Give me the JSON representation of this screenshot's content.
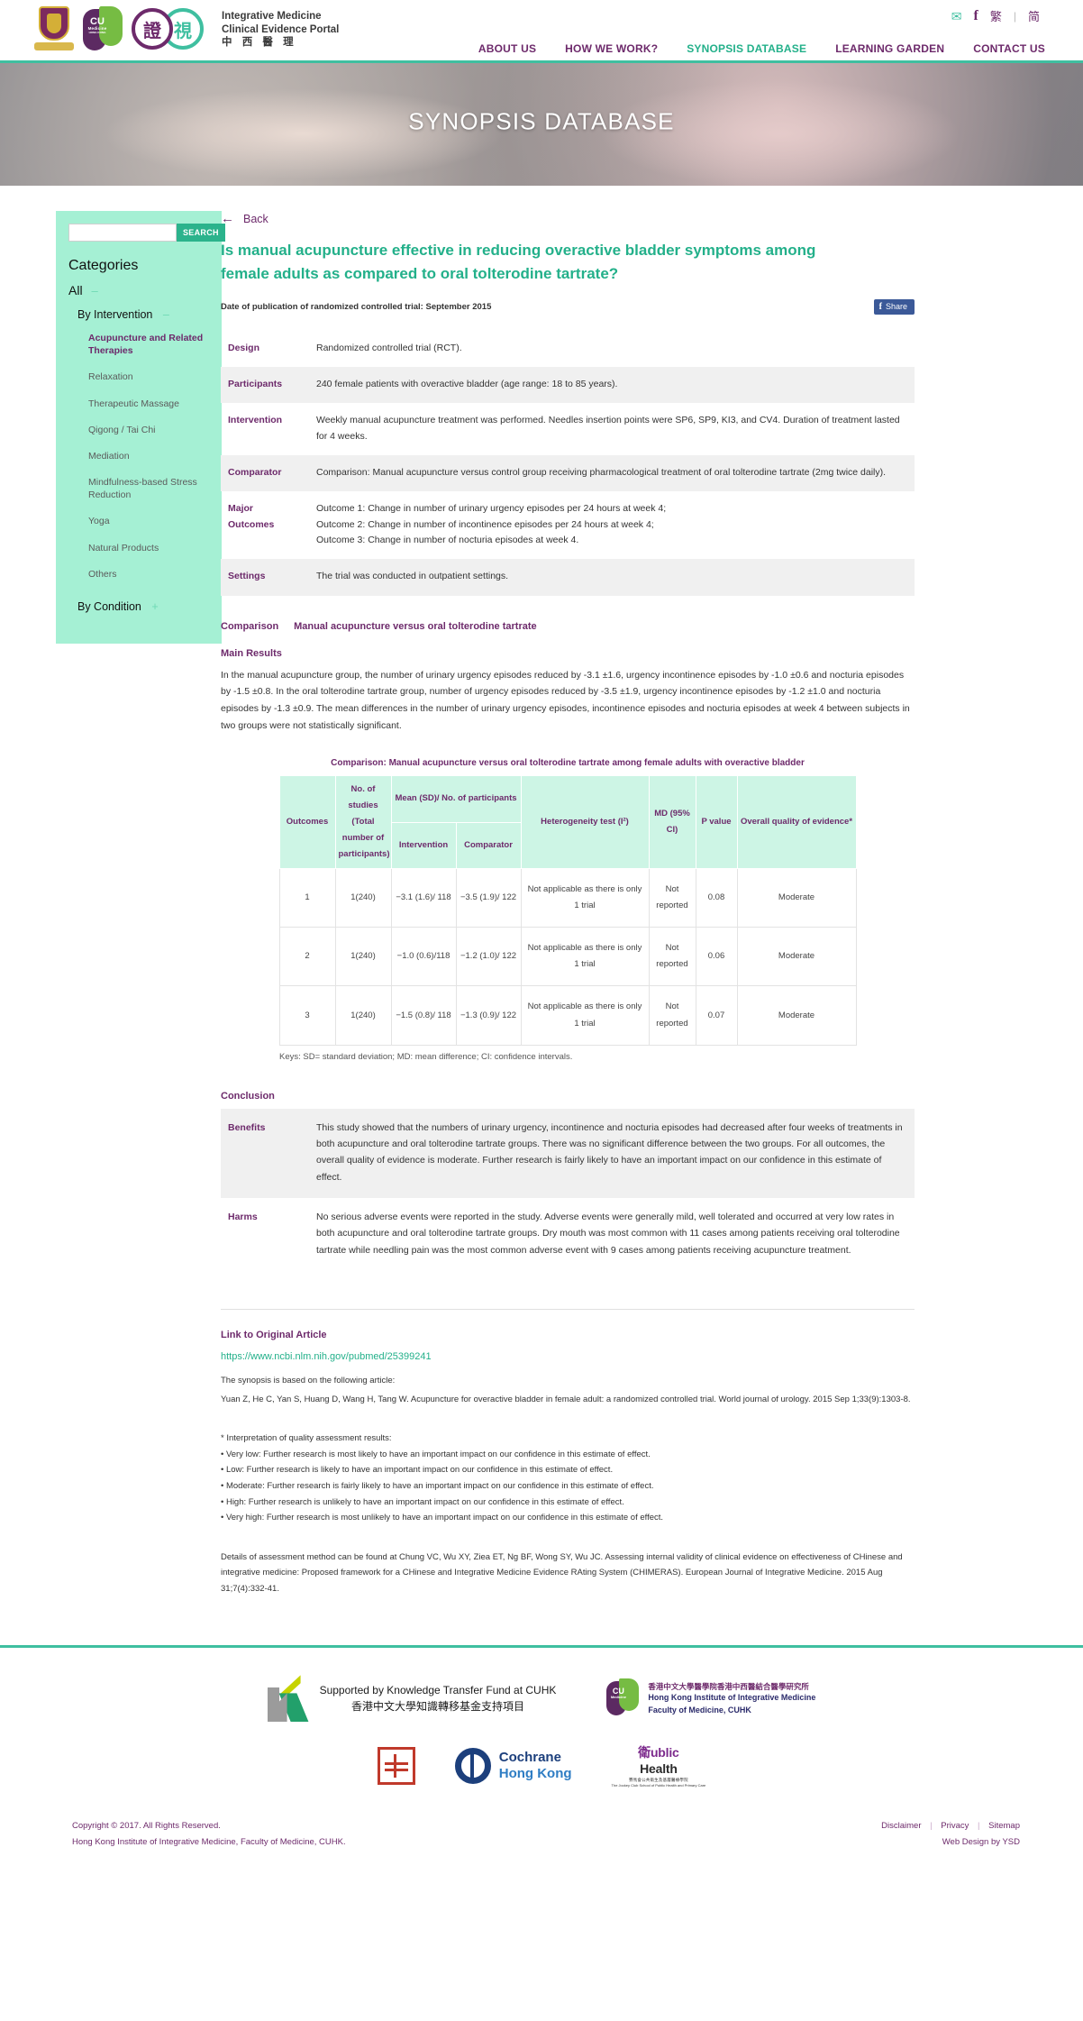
{
  "header": {
    "brand": {
      "line1": "Integrative Medicine",
      "line2": "Clinical Evidence Portal",
      "line3": "中 西 醫 理"
    },
    "logo_cu": "CU",
    "logo_cu_sub": "Medicine",
    "logo_cu_sub2": "HONG KONG",
    "logo_mark_left": "證",
    "logo_mark_right": "視",
    "mail_icon": "✉",
    "facebook_icon": "f",
    "lang_trad": "繁",
    "lang_sep": "|",
    "lang_simp": "简",
    "nav": [
      {
        "label": "ABOUT US",
        "active": false
      },
      {
        "label": "HOW WE WORK?",
        "active": false
      },
      {
        "label": "SYNOPSIS DATABASE",
        "active": true
      },
      {
        "label": "LEARNING GARDEN",
        "active": false
      },
      {
        "label": "CONTACT US",
        "active": false
      }
    ]
  },
  "banner": {
    "title": "SYNOPSIS DATABASE"
  },
  "sidebar": {
    "search_value": "",
    "search_placeholder": "",
    "search_button": "SEARCH",
    "categories_title": "Categories",
    "all_label": "All",
    "all_toggle": "–",
    "by_intervention_label": "By Intervention",
    "by_intervention_toggle": "–",
    "intervention_items": [
      {
        "label": "Acupuncture and Related Therapies",
        "active": true
      },
      {
        "label": "Relaxation",
        "active": false
      },
      {
        "label": "Therapeutic Massage",
        "active": false
      },
      {
        "label": "Qigong / Tai Chi",
        "active": false
      },
      {
        "label": "Mediation",
        "active": false
      },
      {
        "label": "Mindfulness-based Stress Reduction",
        "active": false
      },
      {
        "label": "Yoga",
        "active": false
      },
      {
        "label": "Natural Products",
        "active": false
      },
      {
        "label": "Others",
        "active": false
      }
    ],
    "by_condition_label": "By Condition",
    "by_condition_toggle": "+"
  },
  "main": {
    "back_arrow": "←",
    "back_label": "Back",
    "title": "Is manual acupuncture effective in reducing overactive bladder symptoms among female adults as compared to oral tolterodine tartrate?",
    "publication_date": "Date of publication of randomized controlled trial: September 2015",
    "share_label": "Share",
    "share_icon": "f",
    "info_rows": [
      {
        "label": "Design",
        "value": "Randomized controlled trial (RCT)."
      },
      {
        "label": "Participants",
        "value": "240 female patients with overactive bladder (age range: 18 to 85 years)."
      },
      {
        "label": "Intervention",
        "value": "Weekly manual acupuncture treatment was performed. Needles insertion points were SP6, SP9, KI3, and CV4. Duration of treatment lasted for 4 weeks."
      },
      {
        "label": "Comparator",
        "value": "Comparison: Manual acupuncture versus control group receiving pharmacological treatment of oral tolterodine tartrate (2mg twice daily)."
      },
      {
        "label": "Major Outcomes",
        "value": "Outcome 1: Change in number of urinary urgency episodes per 24 hours at week 4;\nOutcome 2: Change in number of incontinence episodes per 24 hours at week 4;\nOutcome 3: Change in number of nocturia episodes at week 4."
      },
      {
        "label": "Settings",
        "value": "The trial was conducted in outpatient settings."
      }
    ],
    "comparison_label": "Comparison",
    "comparison_value": "Manual acupuncture versus oral tolterodine tartrate",
    "main_results_label": "Main Results",
    "main_results_text": "In the manual acupuncture group, the number of urinary urgency episodes reduced by -3.1 ±1.6, urgency incontinence episodes by -1.0 ±0.6 and nocturia episodes by -1.5 ±0.8. In the oral tolterodine tartrate group, number of urgency episodes reduced by -3.5 ±1.9, urgency incontinence episodes by -1.2 ±1.0 and nocturia episodes by -1.3 ±0.9. The mean differences in the number of urinary urgency episodes, incontinence episodes and nocturia episodes at week 4 between subjects in two groups were not statistically significant.",
    "table_caption": "Comparison: Manual acupuncture versus oral tolterodine tartrate among female adults with overactive bladder",
    "table_keys": "Keys: SD= standard deviation; MD: mean difference; CI: confidence intervals.",
    "conclusion_label": "Conclusion",
    "conclusion_rows": [
      {
        "label": "Benefits",
        "value": "This study showed that the numbers of urinary urgency, incontinence and nocturia episodes had decreased after four weeks of treatments in both acupuncture and oral tolterodine tartrate groups. There was no significant difference between the two groups. For all outcomes, the overall quality of evidence is moderate. Further research is fairly likely to have an important impact on our confidence in this estimate of effect."
      },
      {
        "label": "Harms",
        "value": "No serious adverse events were reported in the study. Adverse events were generally mild, well tolerated and occurred at very low rates in both acupuncture and oral tolterodine tartrate groups. Dry mouth was most common with 11 cases among patients receiving oral tolterodine tartrate while needling pain was the most common adverse event with 9 cases among patients receiving acupuncture treatment."
      }
    ],
    "link_heading": "Link to Original Article",
    "link_url": "https://www.ncbi.nlm.nih.gov/pubmed/25399241",
    "based_on_label": "The synopsis is based on the following article:",
    "citation": "Yuan Z, He C, Yan S, Huang D, Wang H, Tang W. Acupuncture for overactive bladder in female adult: a randomized controlled trial. World journal of urology. 2015 Sep 1;33(9):1303-8.",
    "interp_heading": "* Interpretation of quality assessment results:",
    "interp_bullets": [
      "• Very low: Further research is most likely to have an important impact on our confidence in this estimate of effect.",
      "• Low: Further research is likely to have an important impact on our confidence in this estimate of effect.",
      "• Moderate: Further research is fairly likely to have an important impact on our confidence in this estimate of effect.",
      "• High: Further research is unlikely to have an important impact on our confidence in this estimate of effect.",
      "• Very high: Further research is most unlikely to have an important impact on our confidence in this estimate of effect."
    ],
    "assessment_note": "Details of assessment method can be found at Chung VC, Wu XY, Ziea ET, Ng BF, Wong SY, Wu JC. Assessing internal validity of clinical evidence on effectiveness of CHinese and integrative medicine: Proposed framework for a CHinese and Integrative Medicine Evidence RAting System (CHIMERAS). European Journal of Integrative Medicine. 2015 Aug 31;7(4):332-41."
  },
  "chart_data": {
    "type": "table",
    "title": "Comparison: Manual acupuncture versus oral tolterodine tartrate among female adults with overactive bladder",
    "columns": [
      "Outcomes",
      "No. of studies (Total number of participants)",
      "Mean (SD)/ No. of participants",
      "Heterogeneity test (I²)",
      "MD (95% CI)",
      "P value",
      "Overall quality of evidence*"
    ],
    "subcolumns": [
      "Intervention",
      "Comparator"
    ],
    "rows": [
      {
        "outcome": "1",
        "studies": "1(240)",
        "intervention": "−3.1 (1.6)/ 118",
        "comparator": "−3.5 (1.9)/ 122",
        "heterogeneity": "Not applicable as there is only 1 trial",
        "md": "Not reported",
        "p_value": "0.08",
        "quality": "Moderate"
      },
      {
        "outcome": "2",
        "studies": "1(240)",
        "intervention": "−1.0 (0.6)/118",
        "comparator": "−1.2 (1.0)/ 122",
        "heterogeneity": "Not applicable as there is only 1 trial",
        "md": "Not reported",
        "p_value": "0.06",
        "quality": "Moderate"
      },
      {
        "outcome": "3",
        "studies": "1(240)",
        "intervention": "−1.5 (0.8)/ 118",
        "comparator": "−1.3 (0.9)/ 122",
        "heterogeneity": "Not applicable as there is only 1 trial",
        "md": "Not reported",
        "p_value": "0.07",
        "quality": "Moderate"
      }
    ],
    "footnote": "Keys: SD= standard deviation; MD: mean difference; CI: confidence intervals."
  },
  "footer": {
    "ktf_en": "Supported by Knowledge Transfer Fund at CUHK",
    "ktf_cn": "香港中文大學知識轉移基金支持項目",
    "hkiim_cn": "香港中文大學醫學院香港中西醫結合醫學研究所",
    "hkiim_en1": "Hong Kong Institute of Integrative Medicine",
    "hkiim_en2": "Faculty of Medicine, CUHK",
    "cochrane_1": "Cochrane",
    "cochrane_2": "Hong Kong",
    "jcsph_top": "衛ublic",
    "jcsph_top2": "Health",
    "jcsph_cn": "賽馬會公共衛生及基層醫療學院",
    "jcsph_en": "The Jockey Club School of Public Health and Primary Care",
    "copyright_1": "Copyright © 2017. All Rights Reserved.",
    "copyright_2": "Hong Kong Institute of Integrative Medicine, Faculty of Medicine, CUHK.",
    "links": [
      "Disclaimer",
      "Privacy",
      "Sitemap"
    ],
    "web_design": "Web Design  by YSD"
  }
}
